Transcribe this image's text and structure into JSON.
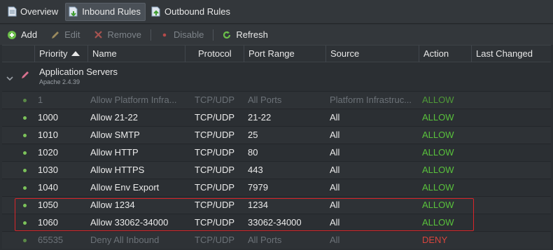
{
  "tabs": [
    {
      "label": "Overview",
      "icon": "overview-page-icon",
      "active": false
    },
    {
      "label": "Inbound Rules",
      "icon": "inbound-rules-icon",
      "active": true
    },
    {
      "label": "Outbound Rules",
      "icon": "outbound-rules-icon",
      "active": false
    }
  ],
  "toolbar": {
    "add": "Add",
    "edit": "Edit",
    "remove": "Remove",
    "disable": "Disable",
    "refresh": "Refresh"
  },
  "columns": {
    "priority": "Priority",
    "name": "Name",
    "protocol": "Protocol",
    "port_range": "Port Range",
    "source": "Source",
    "action": "Action",
    "last_changed": "Last Changed"
  },
  "group": {
    "title": "Application Servers",
    "subtitle": "Apache 2.4.39"
  },
  "rows": [
    {
      "priority": "1",
      "name": "Allow Platform Infra...",
      "protocol": "TCP/UDP",
      "port_range": "All Ports",
      "source": "Platform Infrastruc...",
      "action": "ALLOW",
      "dim": true
    },
    {
      "priority": "1000",
      "name": "Allow 21-22",
      "protocol": "TCP/UDP",
      "port_range": "21-22",
      "source": "All",
      "action": "ALLOW",
      "dim": false
    },
    {
      "priority": "1010",
      "name": "Allow SMTP",
      "protocol": "TCP/UDP",
      "port_range": "25",
      "source": "All",
      "action": "ALLOW",
      "dim": false
    },
    {
      "priority": "1020",
      "name": "Allow HTTP",
      "protocol": "TCP/UDP",
      "port_range": "80",
      "source": "All",
      "action": "ALLOW",
      "dim": false
    },
    {
      "priority": "1030",
      "name": "Allow HTTPS",
      "protocol": "TCP/UDP",
      "port_range": "443",
      "source": "All",
      "action": "ALLOW",
      "dim": false
    },
    {
      "priority": "1040",
      "name": "Allow Env Export",
      "protocol": "TCP/UDP",
      "port_range": "7979",
      "source": "All",
      "action": "ALLOW",
      "dim": false
    },
    {
      "priority": "1050",
      "name": "Allow 1234",
      "protocol": "TCP/UDP",
      "port_range": "1234",
      "source": "All",
      "action": "ALLOW",
      "dim": false
    },
    {
      "priority": "1060",
      "name": "Allow 33062-34000",
      "protocol": "TCP/UDP",
      "port_range": "33062-34000",
      "source": "All",
      "action": "ALLOW",
      "dim": false
    },
    {
      "priority": "65535",
      "name": "Deny All Inbound",
      "protocol": "TCP/UDP",
      "port_range": "All Ports",
      "source": "All",
      "action": "DENY",
      "dim": true
    }
  ],
  "colors": {
    "allow": "#59c23c",
    "deny": "#d8453d",
    "highlight": "#d9252a"
  }
}
